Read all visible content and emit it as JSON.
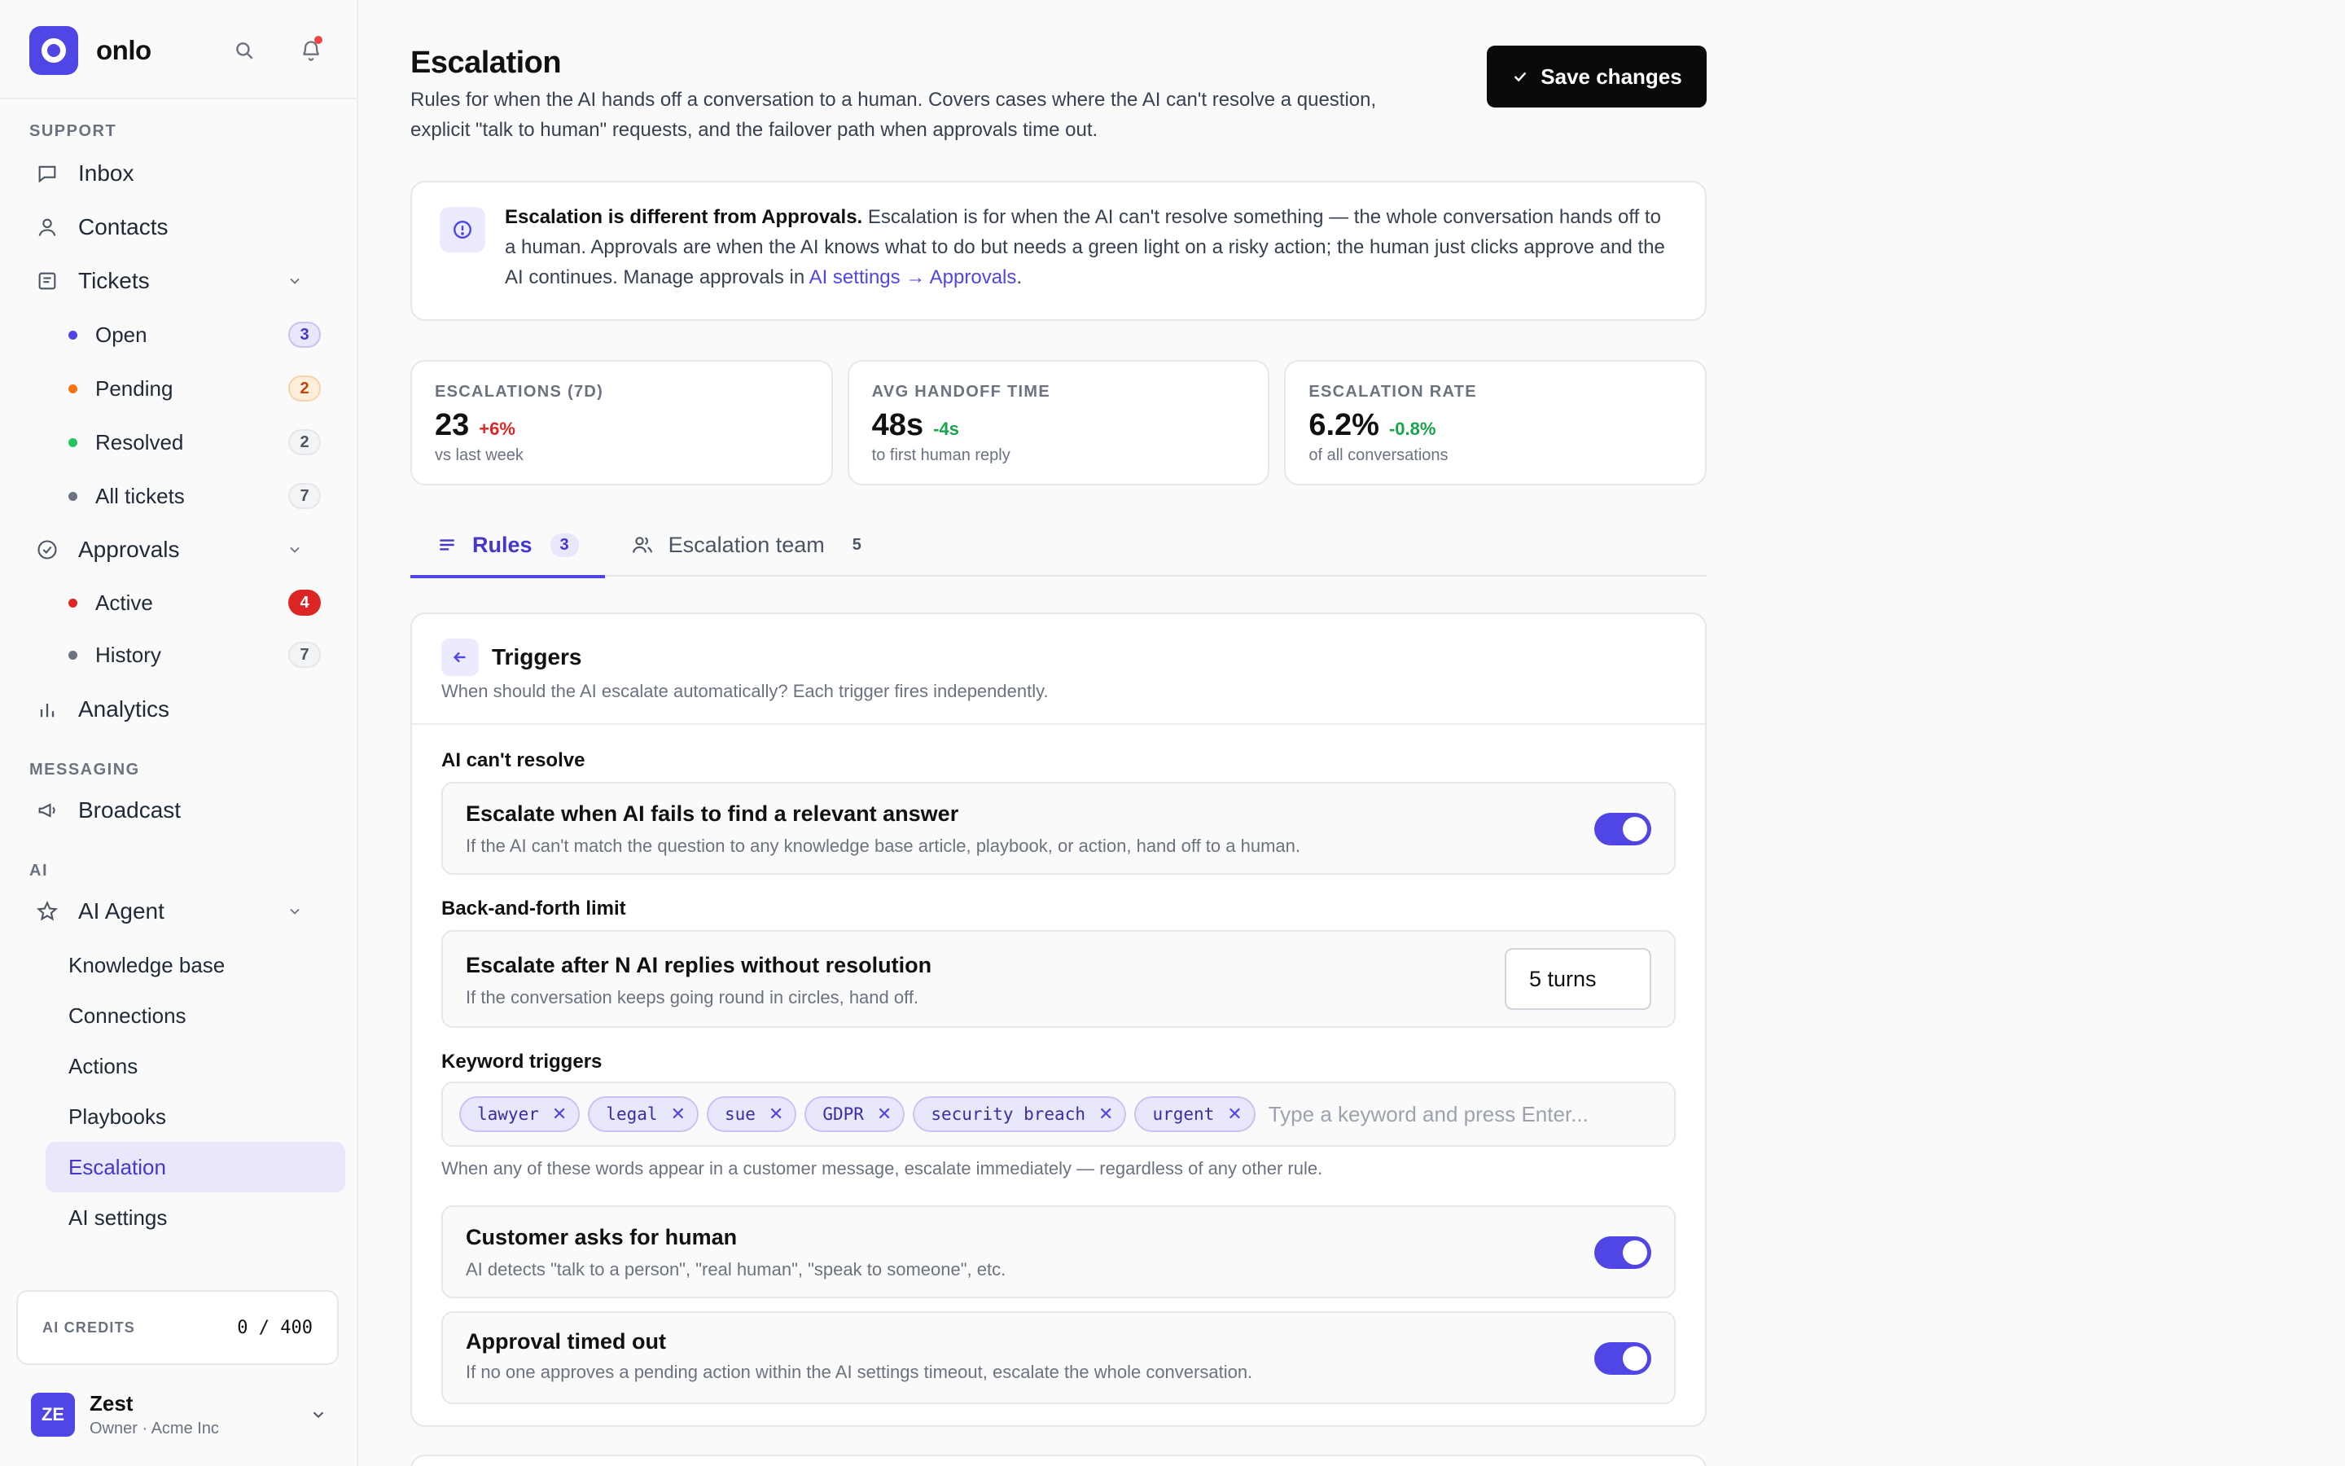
{
  "app": {
    "name": "onlo"
  },
  "sidebar": {
    "sections": {
      "support": "SUPPORT",
      "messaging": "MESSAGING",
      "ai": "AI"
    },
    "inbox": "Inbox",
    "contacts": "Contacts",
    "tickets": {
      "label": "Tickets",
      "items": [
        {
          "label": "Open",
          "count": "3",
          "color": "#4f46e5"
        },
        {
          "label": "Pending",
          "count": "2",
          "color": "#f97316"
        },
        {
          "label": "Resolved",
          "count": "2",
          "color": "#22c55e"
        },
        {
          "label": "All tickets",
          "count": "7",
          "color": "#6b7280"
        }
      ]
    },
    "approvals": {
      "label": "Approvals",
      "items": [
        {
          "label": "Active",
          "count": "4",
          "color": "#dc2626"
        },
        {
          "label": "History",
          "count": "7",
          "color": "#6b7280"
        }
      ]
    },
    "analytics": "Analytics",
    "broadcast": "Broadcast",
    "ai_agent": {
      "label": "AI Agent",
      "items": [
        "Knowledge base",
        "Connections",
        "Actions",
        "Playbooks",
        "Escalation",
        "AI settings"
      ],
      "active": "Escalation"
    },
    "credits": {
      "label": "AI CREDITS",
      "value": "0 / 400"
    },
    "user": {
      "initials": "ZE",
      "name": "Zest",
      "role": "Owner · Acme Inc"
    }
  },
  "header": {
    "title": "Escalation",
    "description": "Rules for when the AI hands off a conversation to a human. Covers cases where the AI can't resolve a question, explicit \"talk to human\" requests, and the failover path when approvals time out.",
    "save_label": "Save changes"
  },
  "info": {
    "bold": "Escalation is different from Approvals.",
    "text": " Escalation is for when the AI can't resolve something — the whole conversation hands off to a human. Approvals are when the AI knows what to do but needs a green light on a risky action; the human just clicks approve and the AI continues. Manage approvals in ",
    "link": "AI settings → Approvals",
    "end": "."
  },
  "stats": [
    {
      "label": "ESCALATIONS (7D)",
      "value": "23",
      "delta": "+6%",
      "delta_color": "#dc2626",
      "sub": "vs last week"
    },
    {
      "label": "AVG HANDOFF TIME",
      "value": "48s",
      "delta": "-4s",
      "delta_color": "#16a34a",
      "sub": "to first human reply"
    },
    {
      "label": "ESCALATION RATE",
      "value": "6.2%",
      "delta": "-0.8%",
      "delta_color": "#16a34a",
      "sub": "of all conversations"
    }
  ],
  "tabs": [
    {
      "label": "Rules",
      "count": "3"
    },
    {
      "label": "Escalation team",
      "count": "5"
    }
  ],
  "triggers": {
    "title": "Triggers",
    "description": "When should the AI escalate automatically? Each trigger fires independently.",
    "groups": {
      "cant_resolve": "AI can't resolve",
      "back_forth": "Back-and-forth limit",
      "keywords": "Keyword triggers"
    },
    "fail_answer": {
      "title": "Escalate when AI fails to find a relevant answer",
      "desc": "If the AI can't match the question to any knowledge base article, playbook, or action, hand off to a human.",
      "enabled": true
    },
    "n_replies": {
      "title": "Escalate after N AI replies without resolution",
      "desc": "If the conversation keeps going round in circles, hand off.",
      "value": "5 turns"
    },
    "keywords": [
      "lawyer",
      "legal",
      "sue",
      "GDPR",
      "security breach",
      "urgent"
    ],
    "keyword_placeholder": "Type a keyword and press Enter...",
    "keyword_help": "When any of these words appear in a customer message, escalate immediately — regardless of any other rule.",
    "ask_human": {
      "title": "Customer asks for human",
      "desc": "AI detects \"talk to a person\", \"real human\", \"speak to someone\", etc.",
      "enabled": true
    },
    "approval_timeout": {
      "title": "Approval timed out",
      "desc": "If no one approves a pending action within the AI settings timeout, escalate the whole conversation.",
      "enabled": true
    }
  }
}
